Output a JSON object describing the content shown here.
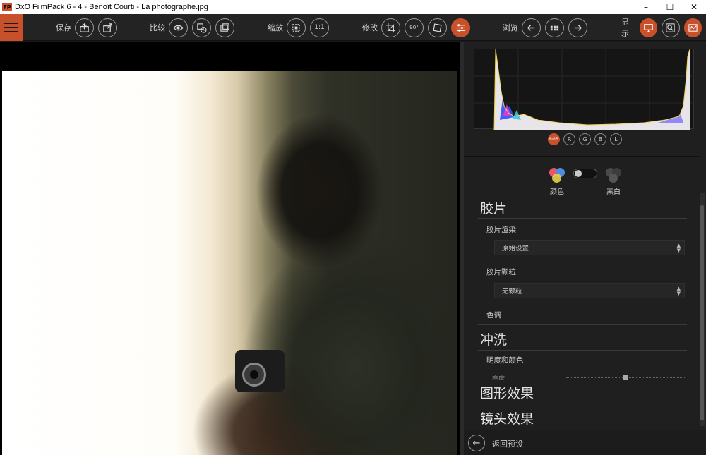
{
  "window": {
    "app_icon": "FP",
    "title": "DxO FilmPack 6 - 4 - Benoît Courti - La photographe.jpg",
    "minimize": "–",
    "maximize": "☐",
    "close": "✕"
  },
  "toolbar": {
    "save_label": "保存",
    "compare_label": "比较",
    "zoom_label": "缩放",
    "zoom_1to1": "1:1",
    "edit_label": "修改",
    "rotate_label": "90°",
    "browse_label": "浏览",
    "display_label": "显示",
    "accent_color": "#c8502a"
  },
  "histogram": {
    "tabs": [
      "RGB",
      "R",
      "G",
      "B",
      "L"
    ],
    "active_tab": "RGB"
  },
  "mode": {
    "color_label": "颜色",
    "bw_label": "黑白"
  },
  "sections": {
    "film": {
      "title": "胶片",
      "rendering_label": "胶片渲染",
      "rendering_value": "原始设置",
      "grain_label": "胶片颗粒",
      "grain_value": "无颗粒",
      "tone_label": "色调"
    },
    "develop": {
      "title": "冲洗",
      "brightness_color_label": "明度和颜色",
      "exposure_label": "亮度"
    },
    "graphic_effects": {
      "title": "图形效果"
    },
    "lens_effects": {
      "title": "镜头效果"
    }
  },
  "footer": {
    "back_label": "返回预设"
  }
}
